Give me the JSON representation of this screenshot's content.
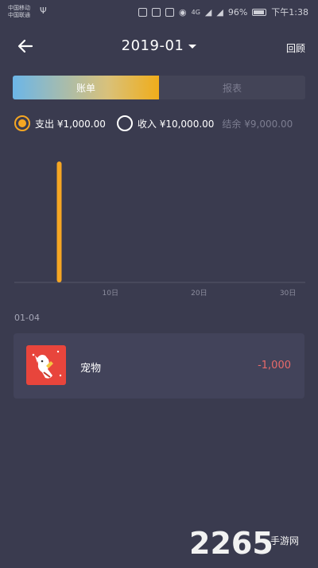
{
  "status_bar": {
    "carrier_1": "中国移动",
    "carrier_2": "中国联通",
    "network": "4G",
    "battery": "96%",
    "time": "下午1:38"
  },
  "header": {
    "title": "2019-01",
    "review_label": "回顾"
  },
  "tabs": [
    {
      "label": "账单",
      "active": true
    },
    {
      "label": "报表",
      "active": false
    }
  ],
  "summary": {
    "expense": "支出 ¥1,000.00",
    "income": "收入 ¥10,000.00",
    "balance": "结余 ¥9,000.00"
  },
  "chart_data": {
    "type": "bar",
    "x": [
      4
    ],
    "values": [
      1000
    ],
    "xlim": [
      1,
      31
    ],
    "ylim": [
      0,
      1000
    ],
    "tick_labels": [
      "10日",
      "20日",
      "30日"
    ],
    "tick_positions": [
      10,
      20,
      30
    ],
    "bar_color": "#f5a623"
  },
  "list": {
    "date": "01-04",
    "items": [
      {
        "category": "宠物",
        "amount": "-1,000",
        "icon": "pet-dog-icon"
      }
    ]
  },
  "watermark": {
    "brand": "2265",
    "site": "手游网"
  },
  "colors": {
    "accent": "#f5a623",
    "expense_red": "#e86a6a",
    "background": "#3a3b4f"
  }
}
